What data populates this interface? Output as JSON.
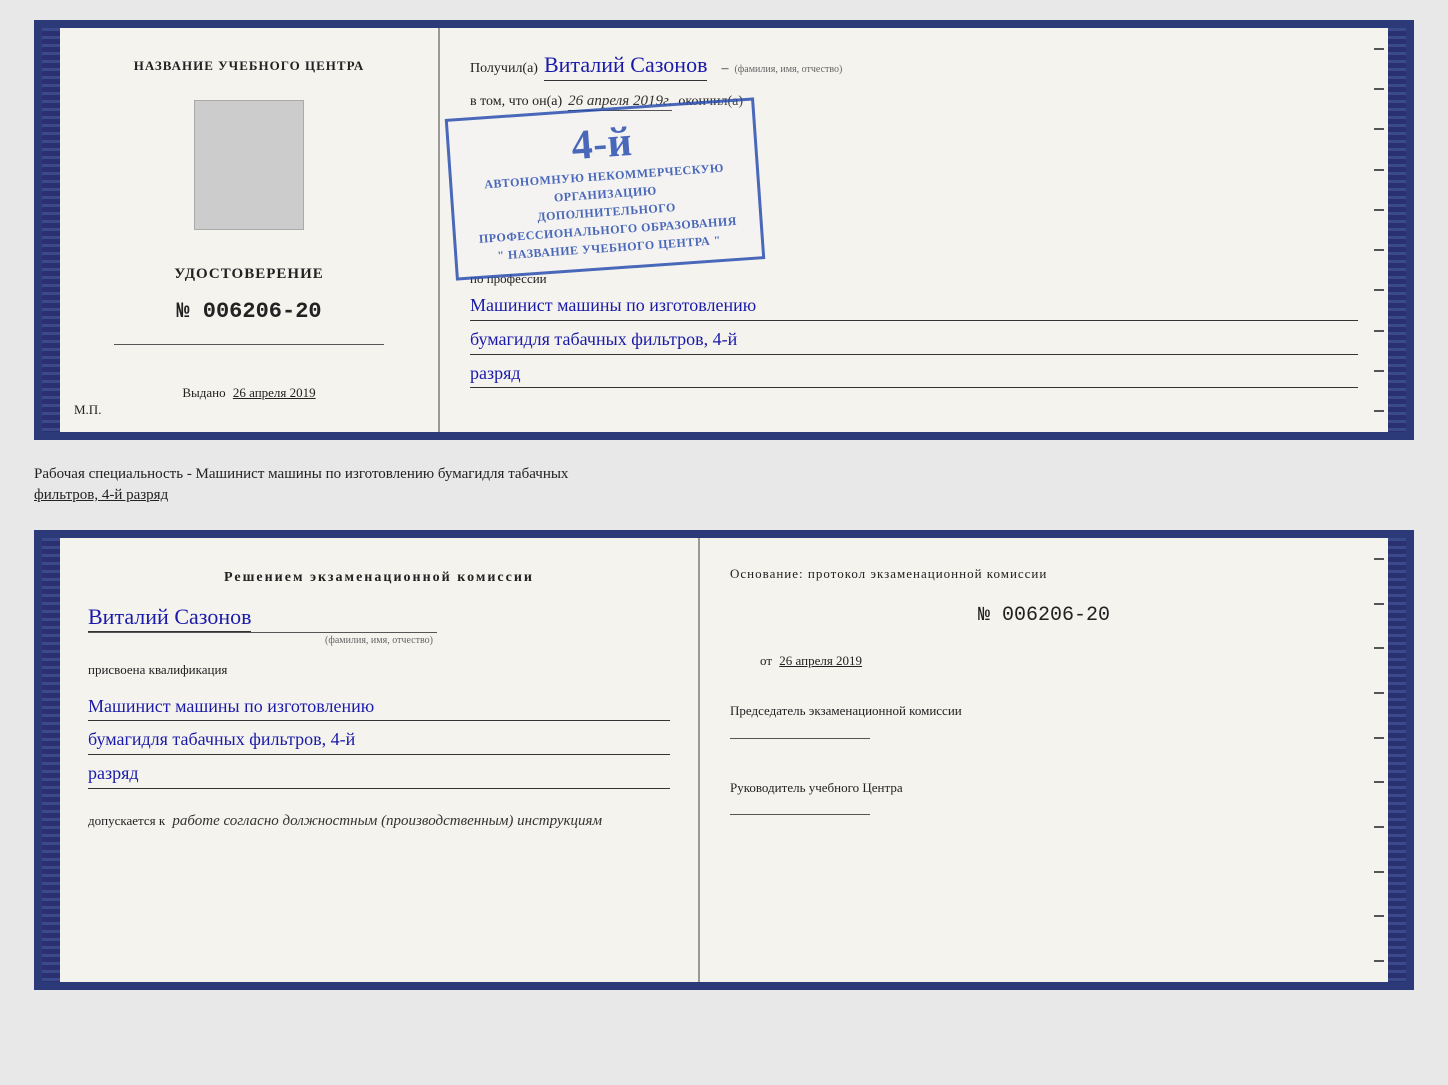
{
  "top_cert": {
    "left": {
      "header": "НАЗВАНИЕ УЧЕБНОГО ЦЕНТРА",
      "cert_label": "УДОСТОВЕРЕНИЕ",
      "cert_number": "№ 006206-20",
      "issued_label": "Выдано",
      "issued_date": "26 апреля 2019",
      "mp": "М.П."
    },
    "right": {
      "received_prefix": "Получил(а)",
      "name_handwritten": "Виталий Сазонов",
      "name_sub": "(фамилия, имя, отчество)",
      "dash": "–",
      "vtom_text": "в том, что он(а)",
      "vtom_date": "26 апреля 2019г.",
      "okoncil": "окончил(а)",
      "stamp_line1": "АВТОНОМНУЮ НЕКОММЕРЧЕСКУЮ ОРГАНИЗАЦИЮ",
      "stamp_line2": "ДОПОЛНИТЕЛЬНОГО ПРОФЕССИОНАЛЬНОГО ОБРАЗОВАНИЯ",
      "stamp_line3": "\" НАЗВАНИЕ УЧЕБНОГО ЦЕНТРА \"",
      "stamp_big": "4-й",
      "profession_prefix": "по профессии",
      "profession_line1": "Машинист машины по изготовлению",
      "profession_line2": "бумагидля табачных фильтров, 4-й",
      "profession_line3": "разряд"
    }
  },
  "middle": {
    "text1": "Рабочая специальность - Машинист машины по изготовлению бумагидля табачных",
    "text2": "фильтров, 4-й разряд"
  },
  "bottom_cert": {
    "left": {
      "decision_title": "Решением  экзаменационной  комиссии",
      "name_handwritten": "Виталий Сазонов",
      "name_sub": "(фамилия, имя, отчество)",
      "qualified_label": "присвоена квалификация",
      "qualification_line1": "Машинист машины по изготовлению",
      "qualification_line2": "бумагидля табачных фильтров, 4-й",
      "qualification_line3": "разряд",
      "allows_prefix": "допускается к",
      "allows_text": "работе согласно должностным (производственным) инструкциям"
    },
    "right": {
      "basis_text": "Основание:  протокол  экзаменационной  комиссии",
      "protocol_number": "№  006206-20",
      "date_prefix": "от",
      "date_value": "26 апреля 2019",
      "chair_title": "Председатель экзаменационной комиссии",
      "head_title": "Руководитель учебного Центра"
    }
  }
}
